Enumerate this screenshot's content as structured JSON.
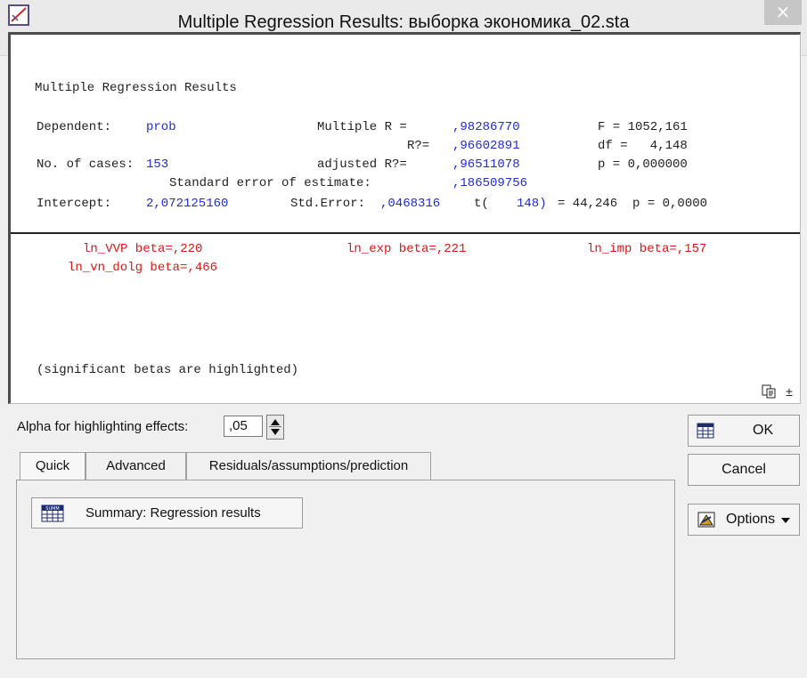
{
  "window": {
    "title": "Multiple Regression Results: выборка экономика_02.sta",
    "close_glyph": "×"
  },
  "results": {
    "heading": "Multiple Regression Results",
    "dependent_label": "Dependent:",
    "dependent_value": "prob",
    "multiple_r_label": "Multiple R =",
    "multiple_r_value": ",98286770",
    "f_label": "F = 1052,161",
    "r2_label": "R?=",
    "r2_value": ",96602891",
    "df_label": "df =   4,148",
    "cases_label": "No. of cases:",
    "cases_value": "153",
    "adj_r2_label": "adjusted R?=",
    "adj_r2_value": ",96511078",
    "p_label": "p = 0,000000",
    "se_label": "Standard error of estimate:",
    "se_value": ",186509756",
    "intercept_label": "Intercept:",
    "intercept_value": "2,072125160",
    "std_error_label": "Std.Error:",
    "std_error_value": ",0468316",
    "t_label": "t(",
    "t_df": "148)",
    "t_value": "= 44,246  p = 0,0000",
    "betas": [
      "ln_VVP beta=,220",
      "ln_exp beta=,221",
      "ln_imp beta=,157",
      "ln_vn_dolg beta=,466"
    ],
    "footnote": "(significant betas are highlighted)"
  },
  "alpha": {
    "label": "Alpha for highlighting effects:",
    "value": ",05"
  },
  "tabs": [
    "Quick",
    "Advanced",
    "Residuals/assumptions/prediction"
  ],
  "quick": {
    "summary_label": "Summary:  Regression results"
  },
  "buttons": {
    "ok": "OK",
    "cancel": "Cancel",
    "options": "Options"
  },
  "icons": {
    "app": "statistica-app-icon",
    "copy": "copy-icon",
    "scroll_up": "scroll-up-icon"
  }
}
